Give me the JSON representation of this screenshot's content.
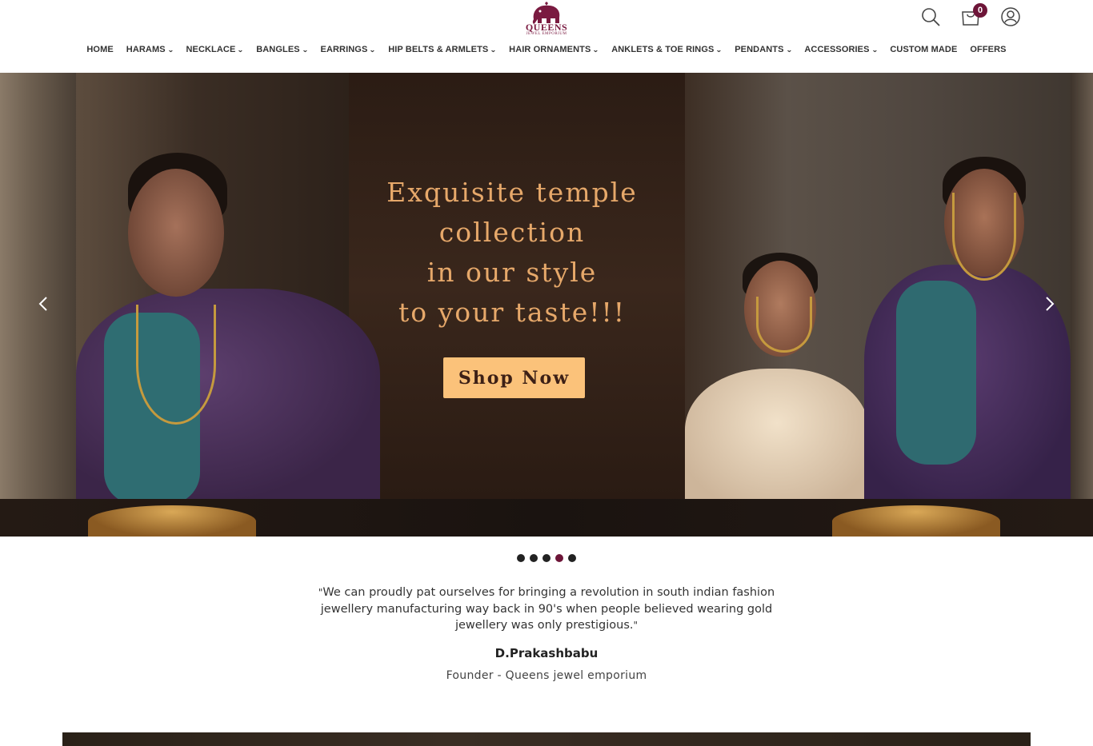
{
  "brand": {
    "name": "QUEENS",
    "tagline": "JEWEL EMPORIUM",
    "accent_color": "#6d1538"
  },
  "header": {
    "icons": {
      "search": "search-icon",
      "cart": "cart-icon",
      "account": "user-icon"
    },
    "cart_count": "0"
  },
  "nav": {
    "items": [
      {
        "label": "HOME",
        "has_dropdown": false
      },
      {
        "label": "HARAMS",
        "has_dropdown": true
      },
      {
        "label": "NECKLACE",
        "has_dropdown": true
      },
      {
        "label": "BANGLES",
        "has_dropdown": true
      },
      {
        "label": "EARRINGS",
        "has_dropdown": true
      },
      {
        "label": "HIP BELTS & ARMLETS",
        "has_dropdown": true
      },
      {
        "label": "HAIR ORNAMENTS",
        "has_dropdown": true
      },
      {
        "label": "ANKLETS & TOE RINGS",
        "has_dropdown": true
      },
      {
        "label": "PENDANTS",
        "has_dropdown": true
      },
      {
        "label": "ACCESSORIES",
        "has_dropdown": true
      },
      {
        "label": "CUSTOM MADE",
        "has_dropdown": false
      },
      {
        "label": "OFFERS",
        "has_dropdown": false
      }
    ]
  },
  "hero": {
    "lines": [
      "Exquisite temple",
      "collection",
      "in our style",
      "to your taste!!!"
    ],
    "cta_label": "Shop Now",
    "cta_color": "#fbc27a",
    "prev_icon": "chevron-left-icon",
    "next_icon": "chevron-right-icon"
  },
  "carousel": {
    "slide_count": 5,
    "active_index": 3
  },
  "testimonial": {
    "quote": "We can proudly pat ourselves for bringing a revolution in south indian fashion jewellery manufacturing way back in 90's when people believed wearing gold jewellery was only prestigious.",
    "author": "D.Prakashbabu",
    "role": "Founder - Queens jewel emporium"
  }
}
